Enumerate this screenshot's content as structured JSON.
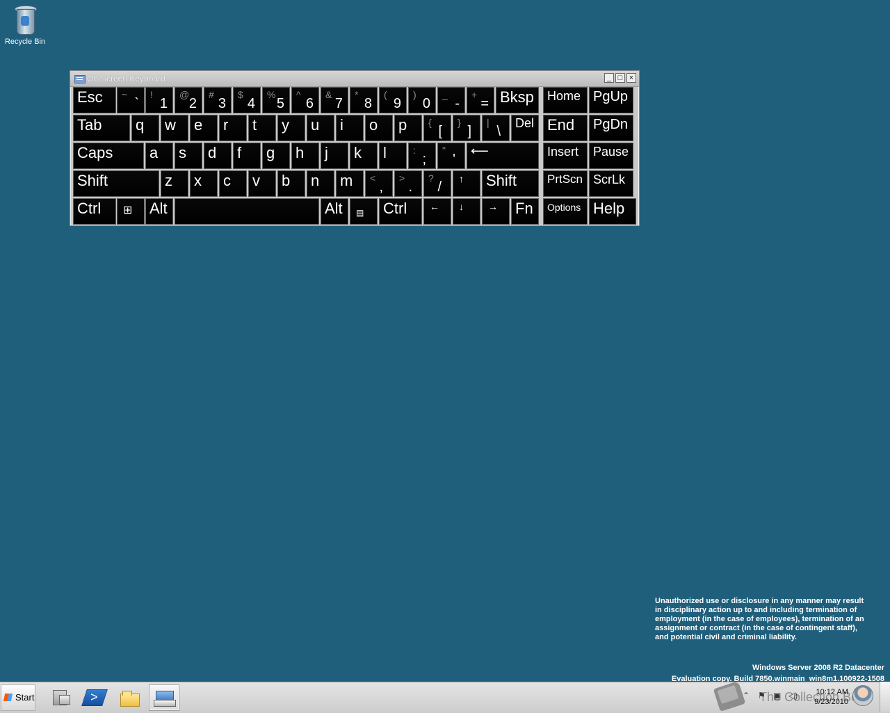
{
  "desktop": {
    "recycle_bin_label": "Recycle Bin"
  },
  "osk": {
    "title": "On-Screen Keyboard",
    "controls": {
      "minimize": "_",
      "maximize": "□",
      "close": "×"
    },
    "keys": {
      "esc": "Esc",
      "tilde_top": "~",
      "tilde_bottom": "`",
      "one_top": "!",
      "one_bottom": "1",
      "two_top": "@",
      "two_bottom": "2",
      "three_top": "#",
      "three_bottom": "3",
      "four_top": "$",
      "four_bottom": "4",
      "five_top": "%",
      "five_bottom": "5",
      "six_top": "^",
      "six_bottom": "6",
      "seven_top": "&",
      "seven_bottom": "7",
      "eight_top": "*",
      "eight_bottom": "8",
      "nine_top": "(",
      "nine_bottom": "9",
      "zero_top": ")",
      "zero_bottom": "0",
      "minus_top": "_",
      "minus_bottom": "-",
      "equals_top": "+",
      "equals_bottom": "=",
      "bksp": "Bksp",
      "home": "Home",
      "pgup": "PgUp",
      "tab": "Tab",
      "q": "q",
      "w": "w",
      "e": "e",
      "r": "r",
      "t": "t",
      "y": "y",
      "u": "u",
      "i": "i",
      "o": "o",
      "p": "p",
      "lbrace_top": "{",
      "lbrace_bottom": "[",
      "rbrace_top": "}",
      "rbrace_bottom": "]",
      "pipe_top": "|",
      "pipe_bottom": "\\",
      "del": "Del",
      "end": "End",
      "pgdn": "PgDn",
      "caps": "Caps",
      "a": "a",
      "s": "s",
      "d": "d",
      "f": "f",
      "g": "g",
      "h": "h",
      "j": "j",
      "k": "k",
      "l": "l",
      "colon_top": ":",
      "colon_bottom": ";",
      "quote_top": "\"",
      "quote_bottom": "'",
      "enter": "⟵",
      "insert": "Insert",
      "pause": "Pause",
      "shift_left": "Shift",
      "z": "z",
      "x": "x",
      "c": "c",
      "v": "v",
      "b": "b",
      "n": "n",
      "m": "m",
      "comma_top": "<",
      "comma_bottom": ",",
      "period_top": ">",
      "period_bottom": ".",
      "slash_top": "?",
      "slash_bottom": "/",
      "up": "↑",
      "shift_right": "Shift",
      "prtscn": "PrtScn",
      "scrlk": "ScrLk",
      "ctrl_left": "Ctrl",
      "win": "⊞",
      "alt_left": "Alt",
      "space": "",
      "alt_right": "Alt",
      "menu": "▤",
      "ctrl_right": "Ctrl",
      "left": "←",
      "down": "↓",
      "right": "→",
      "fn": "Fn",
      "options": "Options",
      "help": "Help"
    }
  },
  "watermark": {
    "message": "Unauthorized use or disclosure in any manner may result\nin disciplinary action up to and including termination of\nemployment (in the case of employees), termination of an\nassignment or contract (in the case of contingent staff),\nand potential civil and criminal liability.",
    "server": "Windows Server 2008 R2 Datacenter",
    "build": "Evaluation copy. Build 7850.winmain_win8m1.100922-1508"
  },
  "taskbar": {
    "start_label": "Start",
    "overlay_text": "The Collection Book",
    "time": "10:12 AM",
    "date": "9/23/2010"
  },
  "icons": {
    "recycle_bin": "recycle-bin-icon",
    "server_manager": "server-manager-icon",
    "powershell": "powershell-icon",
    "explorer": "folder-icon",
    "keyboard": "on-screen-keyboard-icon",
    "network": "network-icon",
    "volume": "volume-icon",
    "flag": "action-center-icon",
    "arrow": "chevron-up-icon",
    "user": "user-avatar-icon"
  }
}
